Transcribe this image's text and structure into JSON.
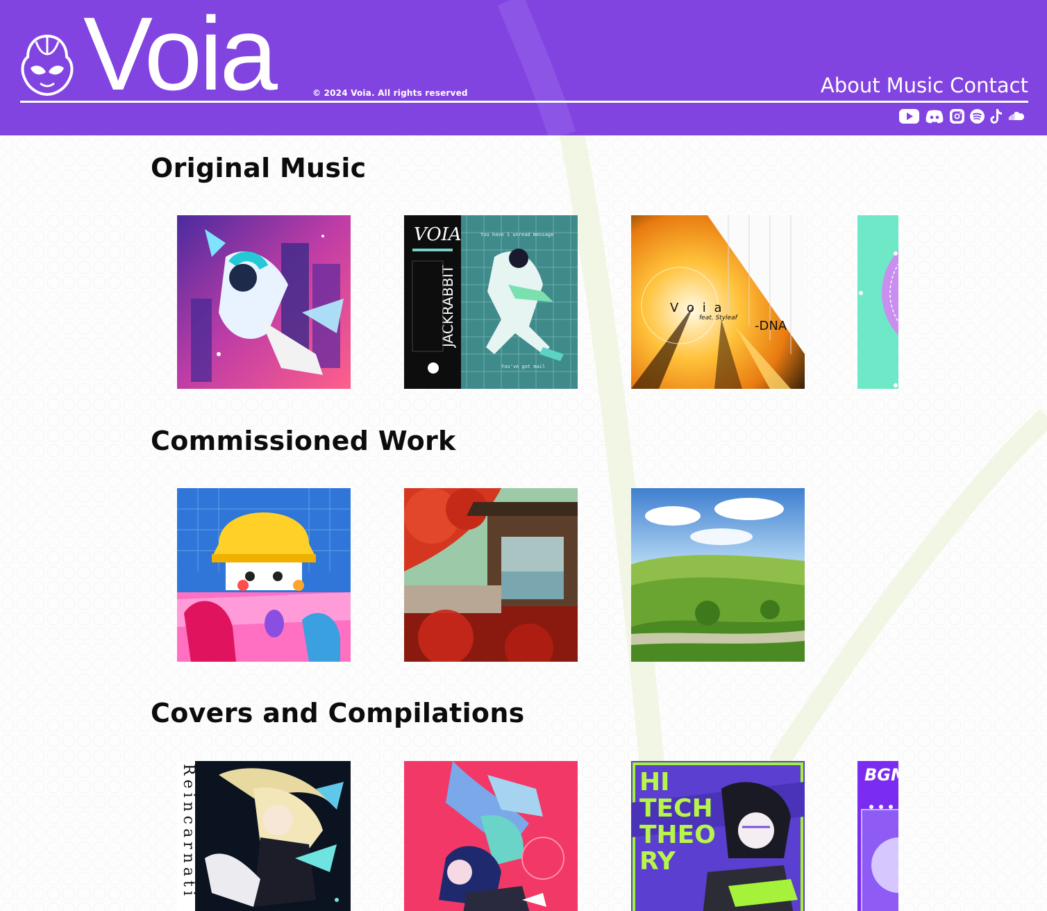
{
  "site": {
    "logo_text": "Voia",
    "copyright": "© 2024 Voia. All rights reserved"
  },
  "nav": [
    {
      "label": "About"
    },
    {
      "label": "Music"
    },
    {
      "label": "Contact"
    }
  ],
  "socials": [
    {
      "icon": "youtube-icon"
    },
    {
      "icon": "discord-icon"
    },
    {
      "icon": "instagram-icon"
    },
    {
      "icon": "spotify-icon"
    },
    {
      "icon": "tiktok-icon"
    },
    {
      "icon": "soundcloud-icon"
    }
  ],
  "sections": [
    {
      "title": "Original Music"
    },
    {
      "title": "Commissioned Work"
    },
    {
      "title": "Covers and Compilations"
    }
  ],
  "artwork_text": {
    "jackrabbit_logo": "VOIA",
    "jackrabbit_title": "JACKRABBIT",
    "jackrabbit_msg1": "You have 1 unread message",
    "jackrabbit_msg2": "You've got mail",
    "dna_artist": "V o i a",
    "dna_feat": "feat. Styleaf",
    "dna_title": "-DNA",
    "reincarnation": "Reincarnati",
    "hitech_line1": "HI",
    "hitech_line2": "TECH",
    "hitech_line3": "THEO",
    "hitech_line4": "RY",
    "bgm": "BGM"
  },
  "colors": {
    "header_bg": "#8244e0",
    "text": "#0c0c0c",
    "header_text": "#ffffff"
  }
}
